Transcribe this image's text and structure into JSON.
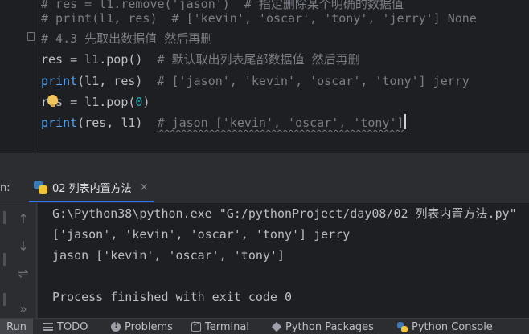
{
  "editor": {
    "lines": [
      {
        "parts": [
          {
            "t": "# res = l1.remove('jason')  # 指定删除某个明确的数据值",
            "c": "cmt"
          }
        ]
      },
      {
        "parts": [
          {
            "t": "# print(l1, res)  # ['kevin', 'oscar', 'tony', 'jerry'] None",
            "c": "cmt"
          }
        ]
      },
      {
        "parts": [
          {
            "t": "# 4.3 先取出数据值 然后再删",
            "c": "cmt"
          }
        ]
      },
      {
        "parts": [
          {
            "t": "res = l1.pop()  ",
            "c": "par"
          },
          {
            "t": "# 默认取出列表尾部数据值 然后再删",
            "c": "cmt"
          }
        ]
      },
      {
        "parts": [
          {
            "t": "print",
            "c": "kw"
          },
          {
            "t": "(l1, res)  ",
            "c": "par"
          },
          {
            "t": "# ['jason', 'kevin', 'oscar', 'tony'] jerry",
            "c": "cmt"
          }
        ]
      },
      {
        "parts": [
          {
            "t": "res = l1.pop(",
            "c": "par"
          },
          {
            "t": "0",
            "c": "num"
          },
          {
            "t": ")",
            "c": "par"
          }
        ]
      },
      {
        "parts": [
          {
            "t": "print",
            "c": "kw"
          },
          {
            "t": "(res, l1)  ",
            "c": "par"
          },
          {
            "t": "# jason ['kevin', 'oscar', 'tony']",
            "c": "cmt wavy"
          }
        ]
      }
    ]
  },
  "run_panel": {
    "prefix": "n:",
    "tab_label": "02 列表内置方法",
    "close_glyph": "×"
  },
  "console": {
    "lines": [
      "G:\\Python38\\python.exe \"G:/pythonProject/day08/02 列表内置方法.py\"",
      "['jason', 'kevin', 'oscar', 'tony'] jerry",
      "jason ['kevin', 'oscar', 'tony']",
      "",
      "Process finished with exit code 0"
    ]
  },
  "sidebar": {
    "up_glyph": "↑",
    "down_glyph": "↓",
    "wrap_glyph": "⇌",
    "more_glyph": "»"
  },
  "bottom_bar": {
    "items": [
      {
        "label": "Run",
        "icon": "run-icon",
        "active": true
      },
      {
        "label": "TODO",
        "icon": "list-icon"
      },
      {
        "label": "Problems",
        "icon": "problems-icon"
      },
      {
        "label": "Terminal",
        "icon": "terminal-icon"
      },
      {
        "label": "Python Packages",
        "icon": "packages-icon"
      },
      {
        "label": "Python Console",
        "icon": "python-console-icon"
      }
    ]
  }
}
